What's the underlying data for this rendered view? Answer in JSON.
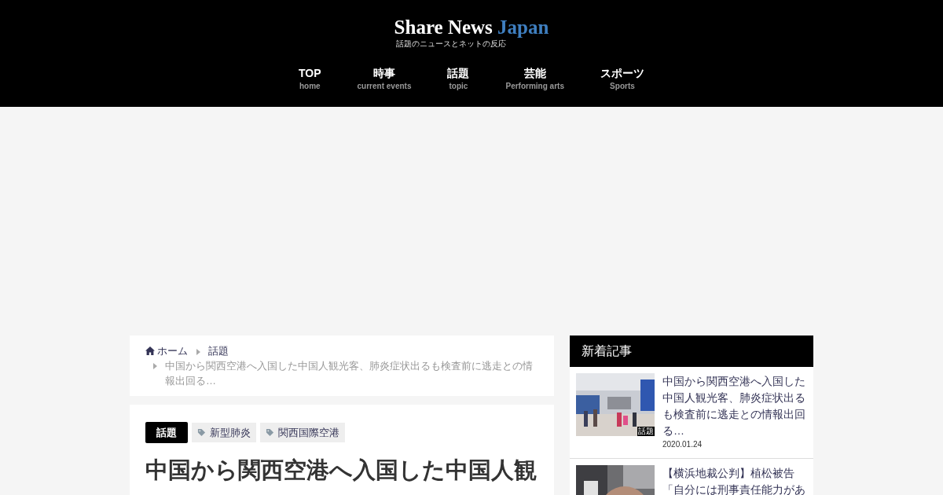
{
  "logo": {
    "title": "Share News",
    "accent": "Japan",
    "tagline": "話題のニュースとネットの反応"
  },
  "nav": [
    {
      "label": "TOP",
      "sub": "home"
    },
    {
      "label": "時事",
      "sub": "current events"
    },
    {
      "label": "話題",
      "sub": "topic"
    },
    {
      "label": "芸能",
      "sub": "Performing arts"
    },
    {
      "label": "スポーツ",
      "sub": "Sports"
    }
  ],
  "breadcrumb": {
    "home": "ホーム",
    "category": "話題",
    "current": "中国から関西空港へ入国した中国人観光客、肺炎症状出るも検査前に逃走との情報出回る…"
  },
  "article": {
    "category": "話題",
    "tags": [
      "新型肺炎",
      "関西国際空港"
    ],
    "title": "中国から関西空港へ入国した中国人観"
  },
  "sidebar": {
    "heading": "新着記事",
    "posts": [
      {
        "title": "中国から関西空港へ入国した中国人観光客、肺炎症状出るも検査前に逃走との情報出回る…",
        "date": "2020.01.24",
        "badge": "話題",
        "kind": "picture"
      },
      {
        "title": "【横浜地裁公判】植松被告「自分には刑事責任能力があ",
        "kind": "picture"
      }
    ]
  }
}
